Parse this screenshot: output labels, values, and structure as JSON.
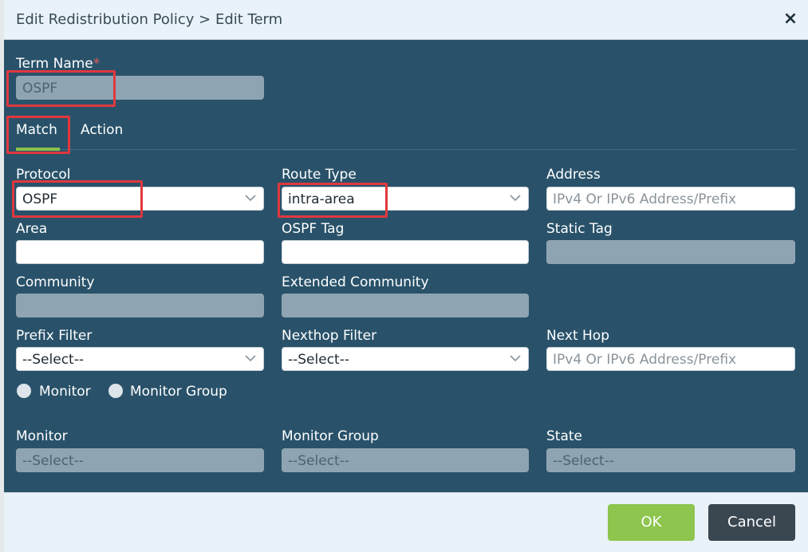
{
  "dialog": {
    "title": "Edit Redistribution Policy > Edit Term",
    "close_symbol": "×"
  },
  "term_name": {
    "label": "Term Name",
    "required_mark": "*",
    "value": "OSPF"
  },
  "tabs": [
    {
      "label": "Match",
      "active": true
    },
    {
      "label": "Action",
      "active": false
    }
  ],
  "fields": {
    "protocol": {
      "label": "Protocol",
      "value": "OSPF"
    },
    "route_type": {
      "label": "Route Type",
      "value": "intra-area"
    },
    "address": {
      "label": "Address",
      "placeholder": "IPv4 Or IPv6 Address/Prefix"
    },
    "area": {
      "label": "Area",
      "value": ""
    },
    "ospf_tag": {
      "label": "OSPF Tag",
      "value": ""
    },
    "static_tag": {
      "label": "Static Tag",
      "value": ""
    },
    "community": {
      "label": "Community",
      "value": ""
    },
    "extended_community": {
      "label": "Extended Community",
      "value": ""
    },
    "prefix_filter": {
      "label": "Prefix Filter",
      "value": "--Select--"
    },
    "nexthop_filter": {
      "label": "Nexthop Filter",
      "value": "--Select--"
    },
    "next_hop": {
      "label": "Next Hop",
      "placeholder": "IPv4 Or IPv6 Address/Prefix"
    },
    "monitor": {
      "label": "Monitor",
      "value": "--Select--"
    },
    "monitor_group": {
      "label": "Monitor Group",
      "value": "--Select--"
    },
    "state": {
      "label": "State",
      "value": "--Select--"
    }
  },
  "radios": {
    "monitor": "Monitor",
    "monitor_group": "Monitor Group"
  },
  "buttons": {
    "ok": "OK",
    "cancel": "Cancel"
  },
  "colors": {
    "panel": "#29526a",
    "highlight": "#e0383e",
    "ok": "#8dc54e",
    "cancel": "#3a4751",
    "active_tab": "#8bc34a"
  }
}
